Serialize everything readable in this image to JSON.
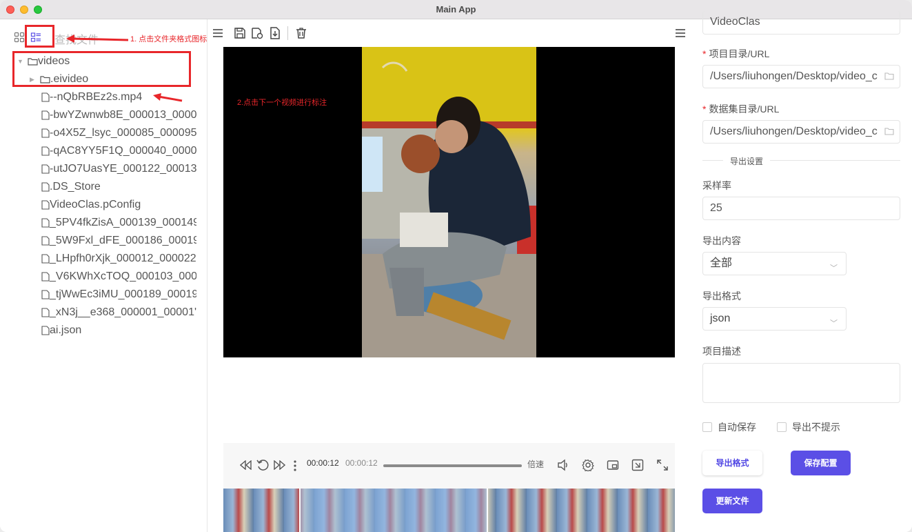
{
  "window": {
    "title": "Main App"
  },
  "sidebar": {
    "search_placeholder": "查找文件",
    "tree": [
      {
        "label": "videos",
        "type": "folder",
        "level": 0,
        "expanded": true
      },
      {
        "label": ".eivideo",
        "type": "folder",
        "level": 1,
        "expanded": false
      },
      {
        "label": "--nQbRBEz2s.mp4",
        "type": "file",
        "level": 1
      },
      {
        "label": "-bwYZwnwb8E_000013_0000",
        "type": "file",
        "level": 1
      },
      {
        "label": "-o4X5Z_lsyc_000085_000095",
        "type": "file",
        "level": 1
      },
      {
        "label": "-qAC8YY5F1Q_000040_0000",
        "type": "file",
        "level": 1
      },
      {
        "label": "-utJO7UasYE_000122_00013:",
        "type": "file",
        "level": 1
      },
      {
        "label": ".DS_Store",
        "type": "file",
        "level": 1
      },
      {
        "label": "VideoClas.pConfig",
        "type": "file",
        "level": 1
      },
      {
        "label": "_5PV4fkZisA_000139_000149",
        "type": "file",
        "level": 1
      },
      {
        "label": "_5W9Fxl_dFE_000186_00019",
        "type": "file",
        "level": 1
      },
      {
        "label": "_LHpfh0rXjk_000012_000022",
        "type": "file",
        "level": 1
      },
      {
        "label": "_V6KWhXcTOQ_000103_000",
        "type": "file",
        "level": 1
      },
      {
        "label": "_tjWwEc3iMU_000189_00019",
        "type": "file",
        "level": 1
      },
      {
        "label": "_xN3j__e368_000001_00001'",
        "type": "file",
        "level": 1
      },
      {
        "label": "ai.json",
        "type": "file",
        "level": 1
      }
    ]
  },
  "annotations": {
    "note1": "1. 点击文件夹格式图标",
    "note2": "2.点击下一个视频进行标注"
  },
  "player": {
    "current_time": "00:00:12",
    "duration": "00:00:12",
    "speed_label": "倍速",
    "progress": 1.0
  },
  "form": {
    "project_name_value": "VideoClas",
    "project_dir_label": "项目目录/URL",
    "project_dir_value": "/Users/liuhongen/Desktop/video_c",
    "dataset_dir_label": "数据集目录/URL",
    "dataset_dir_value": "/Users/liuhongen/Desktop/video_c",
    "export_section": "导出设置",
    "sample_rate_label": "采样率",
    "sample_rate_value": "25",
    "export_content_label": "导出内容",
    "export_content_value": "全部",
    "export_format_label": "导出格式",
    "export_format_value": "json",
    "description_label": "项目描述",
    "description_value": "",
    "auto_save_label": "自动保存",
    "no_prompt_label": "导出不提示",
    "export_format_button": "导出格式",
    "save_config_button": "保存配置",
    "update_file_button": "更新文件"
  },
  "colors": {
    "accent": "#5b4fe6",
    "annotation": "#e8262a"
  }
}
